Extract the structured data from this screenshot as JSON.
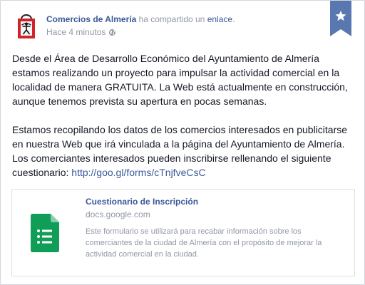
{
  "post": {
    "author": "Comercios de Almería",
    "action_text": "ha compartido un",
    "action_link": "enlace",
    "action_suffix": ".",
    "timestamp": "Hace 4 minutos",
    "paragraph_1": "Desde el Área de Desarrollo Económico del Ayuntamiento de Almería estamos realizando un proyecto para impulsar la actividad comercial en la localidad de manera GRATUITA. La Web está actualmente en construcción, aunque tenemos prevista su apertura en pocas semanas.",
    "paragraph_2": "Estamos recopilando los datos de los comercios interesados en publicitarse en nuestra Web que irá vinculada a la página del Ayuntamiento de Almería. Los comerciantes interesados pueden inscribirse rellenando el siguiente cuestionario: ",
    "link_url": "http://goo.gl/forms/cTnjfveCsC"
  },
  "attachment": {
    "title": "Cuestionario de Inscripción",
    "domain": "docs.google.com",
    "description": "Este formulario se utilizará para recabar información sobre los comerciantes de la ciudad de Almería con el propósito de mejorar la actividad comercial en la ciudad."
  },
  "icons": {
    "avatar": "shopping-bag-logo",
    "privacy": "globe-icon",
    "bookmark": "star-bookmark-icon",
    "thumbnail": "google-forms-icon"
  },
  "colors": {
    "link": "#3b5998",
    "muted": "#9197a3",
    "bookmark": "#5a78b0",
    "logo_red": "#d2232a",
    "forms_green": "#0f9d58"
  }
}
